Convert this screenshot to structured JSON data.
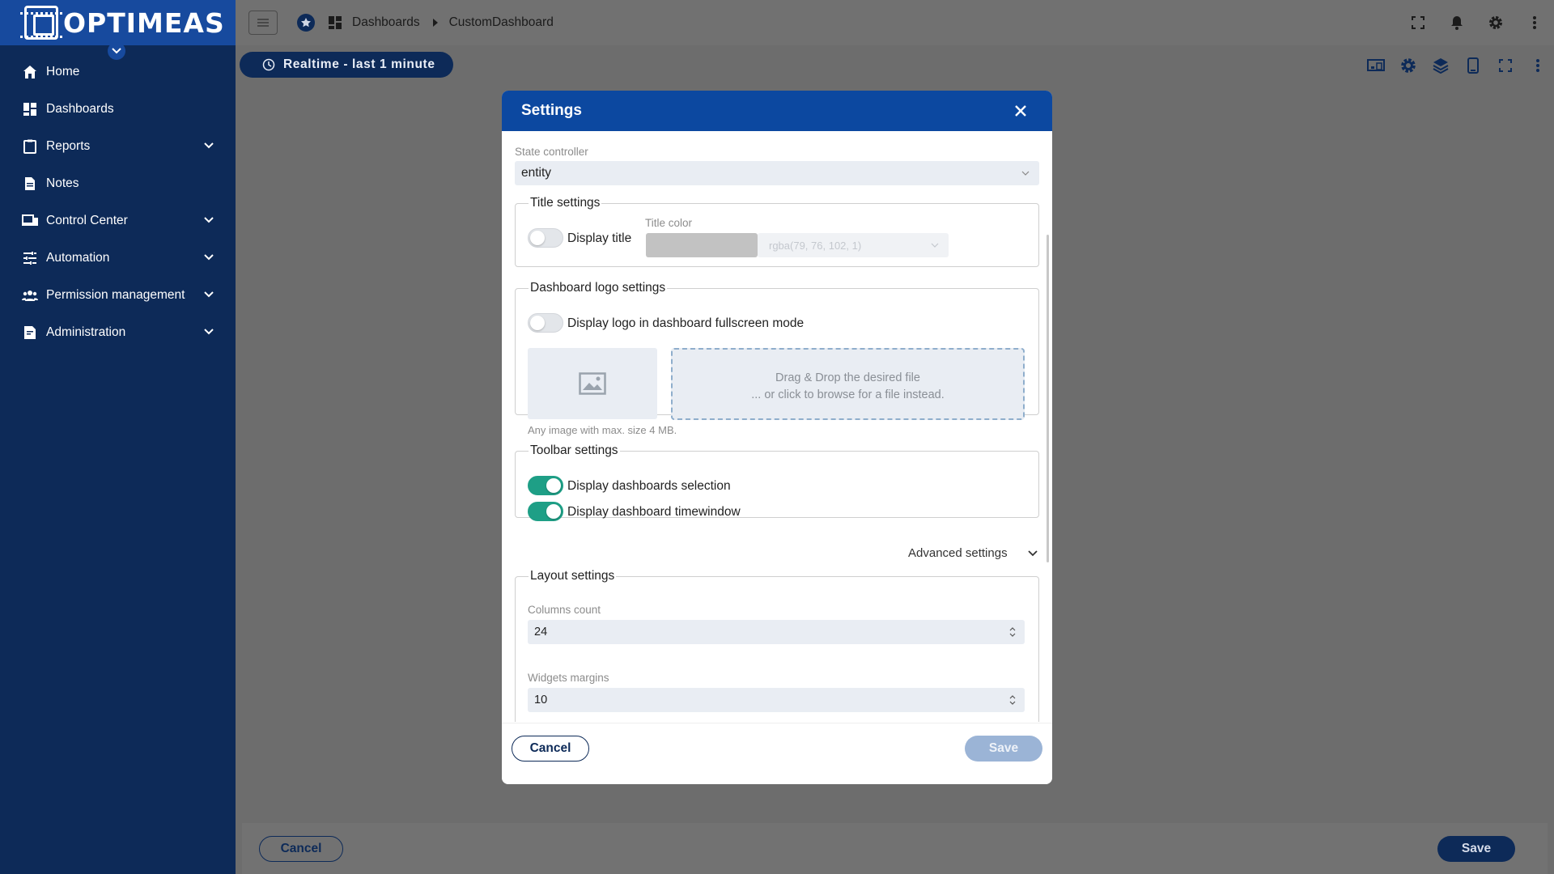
{
  "brand": {
    "logo_text": "OPTIMEAS"
  },
  "sidebar": {
    "items": [
      {
        "label": "Home",
        "icon": "home-icon",
        "expandable": false
      },
      {
        "label": "Dashboards",
        "icon": "dashboard-icon",
        "expandable": false
      },
      {
        "label": "Reports",
        "icon": "clipboard-icon",
        "expandable": true
      },
      {
        "label": "Notes",
        "icon": "note-icon",
        "expandable": false
      },
      {
        "label": "Control Center",
        "icon": "devices-icon",
        "expandable": true
      },
      {
        "label": "Automation",
        "icon": "tune-icon",
        "expandable": true
      },
      {
        "label": "Permission management",
        "icon": "people-icon",
        "expandable": true
      },
      {
        "label": "Administration",
        "icon": "admin-document-icon",
        "expandable": true
      }
    ]
  },
  "topbar": {
    "breadcrumb": [
      "Dashboards",
      "CustomDashboard"
    ]
  },
  "dashboard": {
    "timewindow_label": "Realtime - last 1 minute",
    "footer_cancel": "Cancel",
    "footer_save": "Save"
  },
  "modal": {
    "title": "Settings",
    "state_controller": {
      "label": "State controller",
      "value": "entity"
    },
    "title_settings": {
      "legend": "Title settings",
      "display_title_label": "Display title",
      "display_title_on": false,
      "title_color_label": "Title color",
      "title_color_value": "rgba(79, 76, 102, 1)"
    },
    "logo_settings": {
      "legend": "Dashboard logo settings",
      "display_logo_label": "Display logo in dashboard fullscreen mode",
      "display_logo_on": false,
      "drop_line1": "Drag & Drop the desired file",
      "drop_line2": "... or click to browse for a file instead.",
      "hint": "Any image with max. size 4 MB."
    },
    "toolbar_settings": {
      "legend": "Toolbar settings",
      "display_selection_label": "Display dashboards selection",
      "display_selection_on": true,
      "display_timewindow_label": "Display dashboard timewindow",
      "display_timewindow_on": true
    },
    "advanced_label": "Advanced settings",
    "layout_settings": {
      "legend": "Layout settings",
      "columns_label": "Columns count",
      "columns_value": "24",
      "margins_label": "Widgets margins",
      "margins_value": "10"
    },
    "cancel_label": "Cancel",
    "save_label": "Save"
  },
  "colors": {
    "sidebar_bg": "#0d2a58",
    "brand_bar": "#174a9e",
    "modal_header": "#0c48a0",
    "toggle_on": "#1e9f86"
  }
}
